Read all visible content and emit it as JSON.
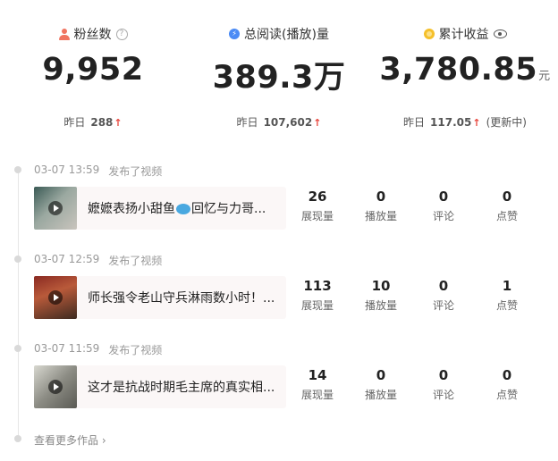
{
  "stats": [
    {
      "label": "粉丝数",
      "value": "9,952",
      "unit": "",
      "yesterday_label": "昨日",
      "yesterday_value": "288",
      "note": "",
      "icon": "user-icon",
      "color": "#f07460"
    },
    {
      "label": "总阅读(播放)量",
      "value": "389.3万",
      "unit": "",
      "yesterday_label": "昨日",
      "yesterday_value": "107,602",
      "note": "",
      "icon": "bolt-icon",
      "color": "#4b8bf5"
    },
    {
      "label": "累计收益",
      "value": "3,780.85",
      "unit": "元",
      "yesterday_label": "昨日",
      "yesterday_value": "117.05",
      "note": "(更新中)",
      "icon": "coin-icon",
      "color": "#f5c02b"
    }
  ],
  "trend_arrow": "↑",
  "posts": [
    {
      "time": "03-07 13:59",
      "action": "发布了视频",
      "title_a": "嬷嬷表扬小甜鱼",
      "title_b": "回忆与力哥...",
      "metrics": [
        {
          "value": "26",
          "label": "展现量"
        },
        {
          "value": "0",
          "label": "播放量"
        },
        {
          "value": "0",
          "label": "评论"
        },
        {
          "value": "0",
          "label": "点赞"
        }
      ]
    },
    {
      "time": "03-07 12:59",
      "action": "发布了视频",
      "title_a": "师长强令老山守兵淋雨数小时！...",
      "title_b": "",
      "metrics": [
        {
          "value": "113",
          "label": "展现量"
        },
        {
          "value": "10",
          "label": "播放量"
        },
        {
          "value": "0",
          "label": "评论"
        },
        {
          "value": "1",
          "label": "点赞"
        }
      ]
    },
    {
      "time": "03-07 11:59",
      "action": "发布了视频",
      "title_a": "这才是抗战时期毛主席的真实相...",
      "title_b": "",
      "metrics": [
        {
          "value": "14",
          "label": "展现量"
        },
        {
          "value": "0",
          "label": "播放量"
        },
        {
          "value": "0",
          "label": "评论"
        },
        {
          "value": "0",
          "label": "点赞"
        }
      ]
    }
  ],
  "more_link": "查看更多作品 ›"
}
